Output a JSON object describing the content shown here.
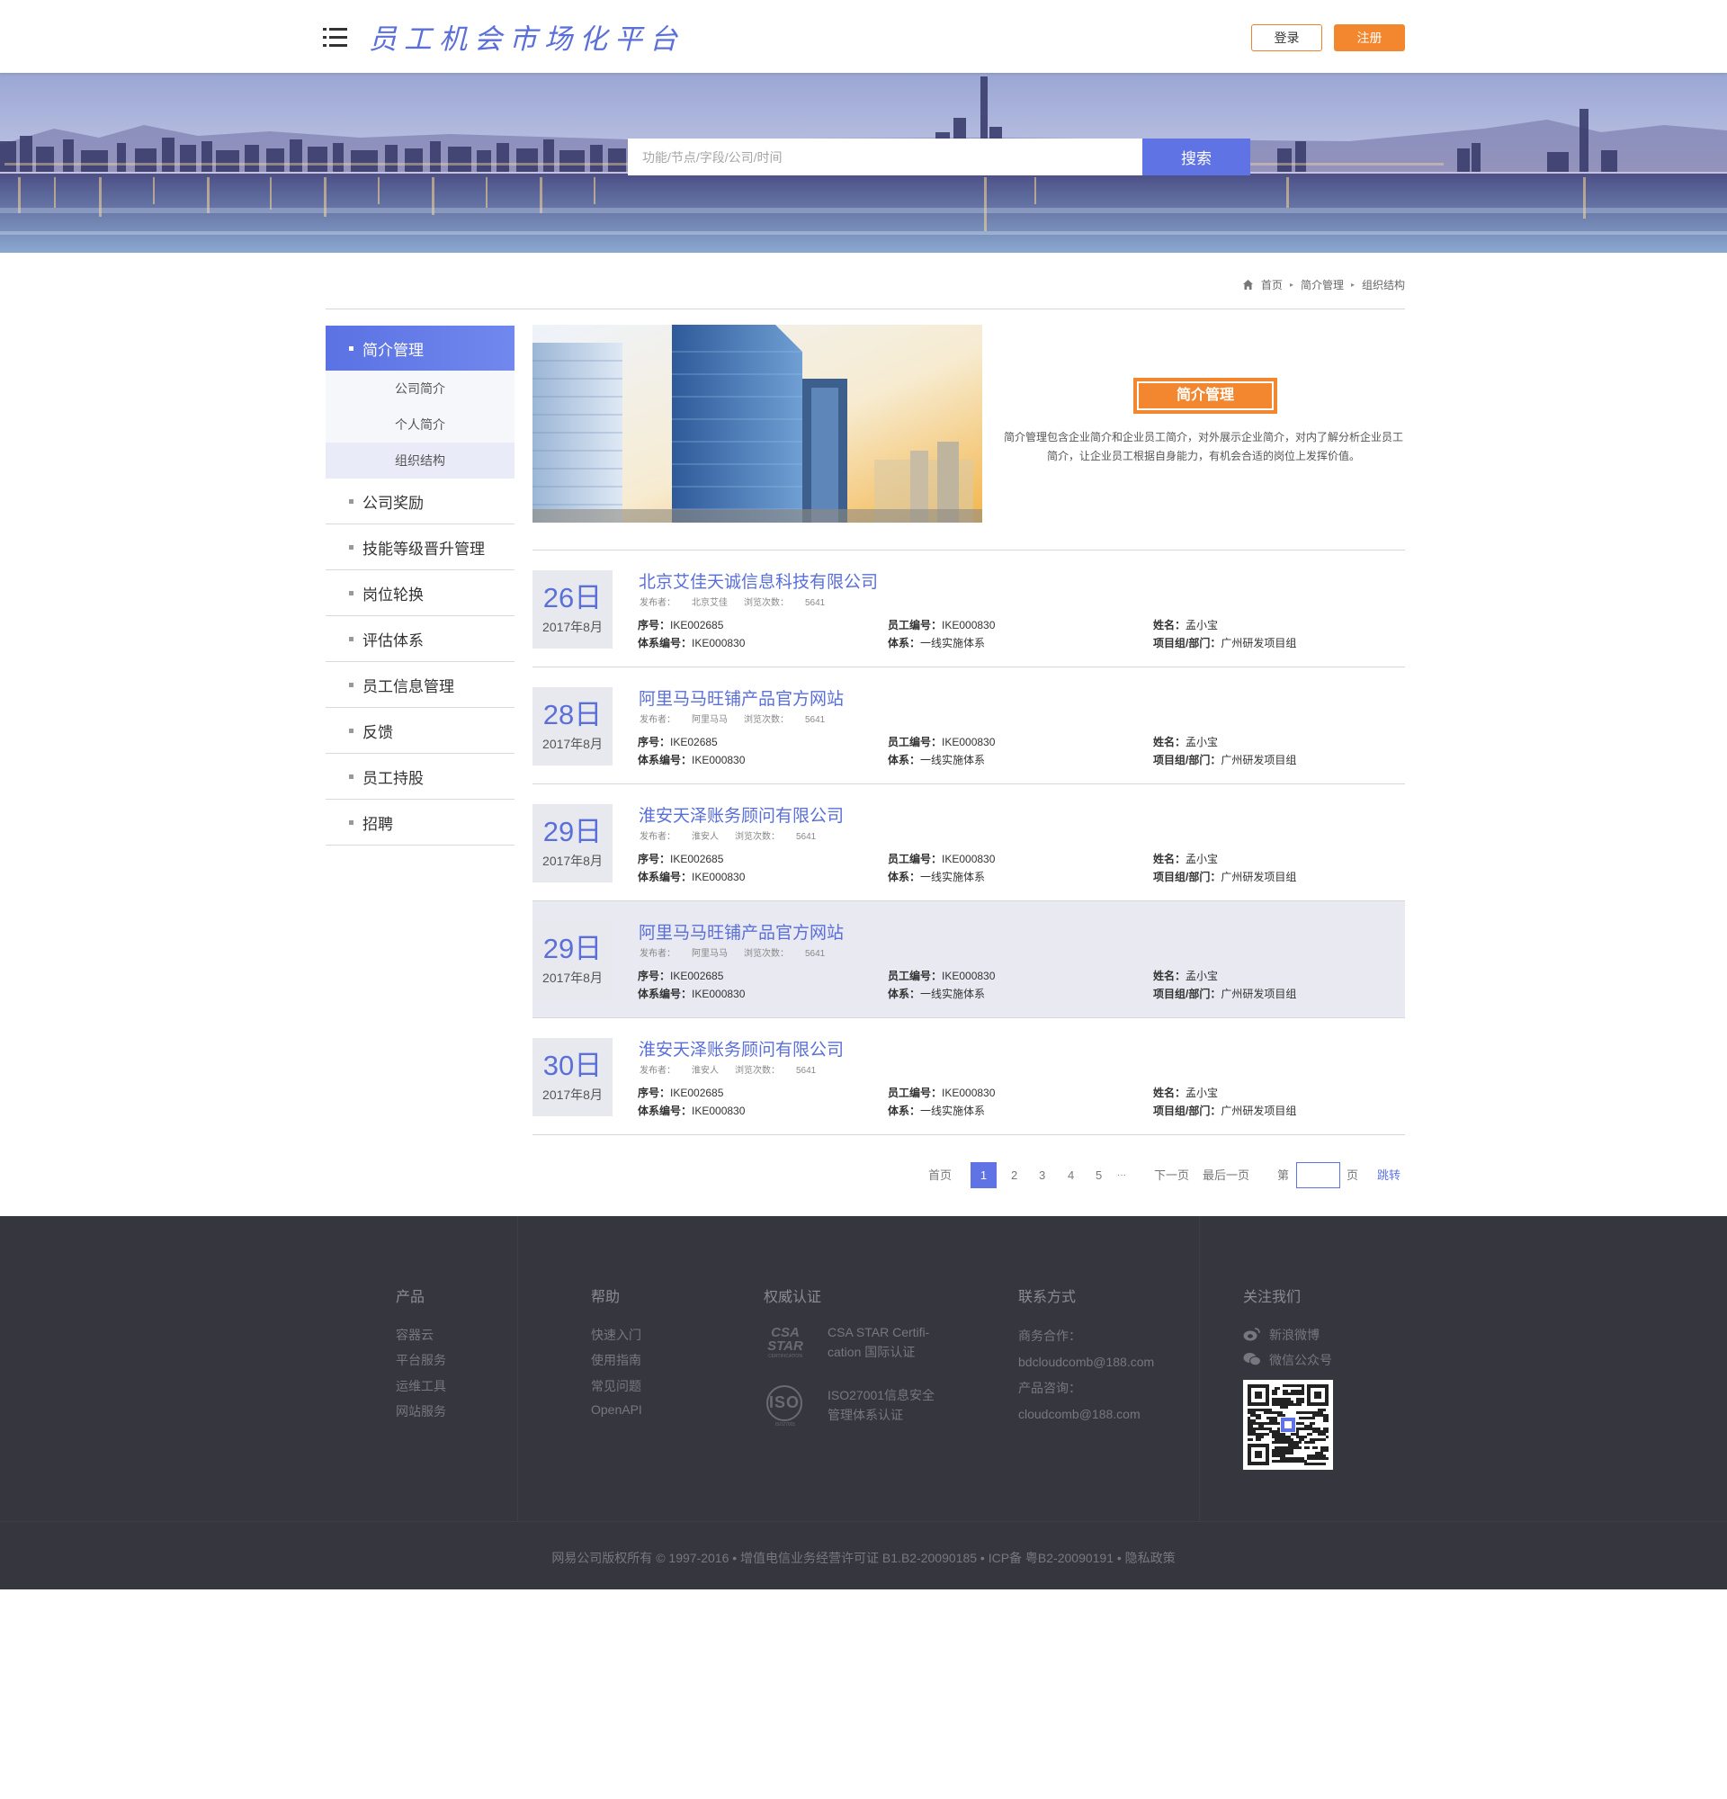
{
  "header": {
    "site_title": "员工机会市场化平台",
    "login_label": "登录",
    "register_label": "注册"
  },
  "search": {
    "placeholder": "功能/节点/字段/公司/时间",
    "button_label": "搜索"
  },
  "breadcrumb": {
    "items": [
      "首页",
      "简介管理",
      "组织结构"
    ]
  },
  "sidebar": {
    "active_label": "简介管理",
    "sub_items": [
      {
        "label": "公司简介",
        "current": false
      },
      {
        "label": "个人简介",
        "current": false
      },
      {
        "label": "组织结构",
        "current": true
      }
    ],
    "items": [
      "公司奖励",
      "技能等级晋升管理",
      "岗位轮换",
      "评估体系",
      "员工信息管理",
      "反馈",
      "员工持股",
      "招聘"
    ]
  },
  "intro": {
    "badge": "简介管理",
    "text": "简介管理包含企业简介和企业员工简介，对外展示企业简介，对内了解分析企业员工简介，让企业员工根据自身能力，有机会合适的岗位上发挥价值。"
  },
  "list": {
    "labels": {
      "publisher": "发布者：",
      "views": "浏览次数：",
      "seq": "序号：",
      "emp_no": "员工编号：",
      "name": "姓名：",
      "sys_no": "体系编号：",
      "system": "体系：",
      "dept": "项目组/部门："
    },
    "rows": [
      {
        "day": "26日",
        "ym": "2017年8月",
        "title": "北京艾佳天诚信息科技有限公司",
        "publisher": "北京艾佳",
        "views": "5641",
        "seq": "IKE002685",
        "emp_no": "IKE000830",
        "name": "孟小宝",
        "sys_no": "IKE000830",
        "system": "一线实施体系",
        "dept": "广州研发项目组",
        "highlight": false
      },
      {
        "day": "28日",
        "ym": "2017年8月",
        "title": "阿里马马旺铺产品官方网站",
        "publisher": "阿里马马",
        "views": "5641",
        "seq": "IKE02685",
        "emp_no": "IKE000830",
        "name": "孟小宝",
        "sys_no": "IKE000830",
        "system": "一线实施体系",
        "dept": "广州研发项目组",
        "highlight": false
      },
      {
        "day": "29日",
        "ym": "2017年8月",
        "title": "淮安天泽账务顾问有限公司",
        "publisher": "淮安人",
        "views": "5641",
        "seq": "IKE002685",
        "emp_no": "IKE000830",
        "name": "孟小宝",
        "sys_no": "IKE000830",
        "system": "一线实施体系",
        "dept": "广州研发项目组",
        "highlight": false
      },
      {
        "day": "29日",
        "ym": "2017年8月",
        "title": "阿里马马旺铺产品官方网站",
        "publisher": "阿里马马",
        "views": "5641",
        "seq": "IKE002685",
        "emp_no": "IKE000830",
        "name": "孟小宝",
        "sys_no": "IKE000830",
        "system": "一线实施体系",
        "dept": "广州研发项目组",
        "highlight": true
      },
      {
        "day": "30日",
        "ym": "2017年8月",
        "title": "淮安天泽账务顾问有限公司",
        "publisher": "淮安人",
        "views": "5641",
        "seq": "IKE002685",
        "emp_no": "IKE000830",
        "name": "孟小宝",
        "sys_no": "IKE000830",
        "system": "一线实施体系",
        "dept": "广州研发项目组",
        "highlight": false
      }
    ]
  },
  "pagination": {
    "first": "首页",
    "pages": [
      "1",
      "2",
      "3",
      "4",
      "5"
    ],
    "current_page": "1",
    "ellipsis": "···",
    "next": "下一页",
    "last": "最后一页",
    "goto_prefix": "第",
    "goto_suffix": "页",
    "jump": "跳转"
  },
  "footer": {
    "products": {
      "title": "产品",
      "links": [
        "容器云",
        "平台服务",
        "运维工具",
        "网站服务"
      ]
    },
    "help": {
      "title": "帮助",
      "links": [
        "快速入门",
        "使用指南",
        "常见问题",
        "OpenAPI"
      ]
    },
    "auth": {
      "title": "权威认证",
      "csa_logo": "CSA STAR",
      "csa_sub": "CERTIFICATION",
      "csa_text": [
        "CSA STAR Certifi-",
        "cation 国际认证"
      ],
      "iso_logo": "ISO",
      "iso_sub": "ISO27001",
      "iso_text": [
        "ISO27001信息安全",
        "管理体系认证"
      ]
    },
    "contact": {
      "title": "联系方式",
      "lines": [
        "商务合作：",
        "bdcloudcomb@188.com",
        "产品咨询：",
        "cloudcomb@188.com"
      ]
    },
    "follow": {
      "title": "关注我们",
      "weibo": "新浪微博",
      "wechat": "微信公众号"
    },
    "copyright": "网易公司版权所有 © 1997-2016  •  增值电信业务经营许可证 B1.B2-20090185  •  ICP备 粤B2-20090191  •  隐私政策"
  },
  "colors": {
    "accent_blue": "#5f73e4",
    "accent_orange": "#f3872f",
    "footer_bg": "#36363e"
  },
  "icons": [
    "menu-icon",
    "home-icon",
    "weibo-icon",
    "wechat-icon",
    "qr-code"
  ]
}
